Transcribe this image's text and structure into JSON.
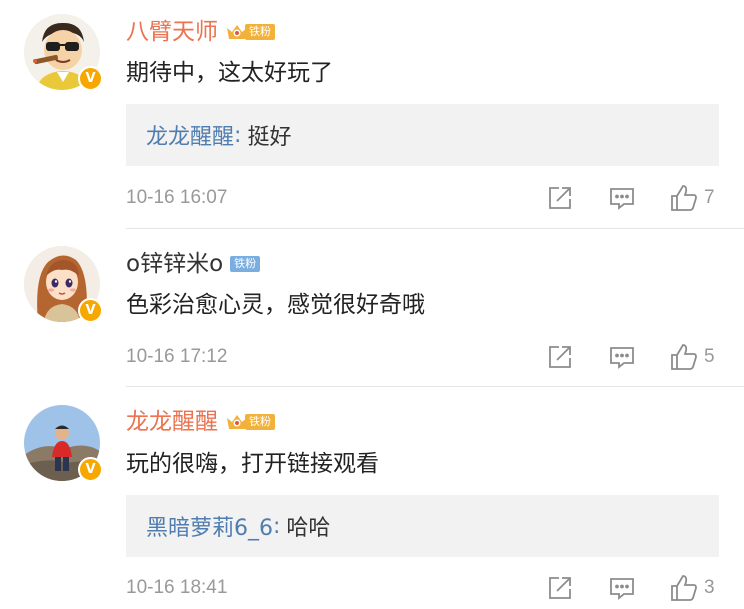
{
  "comments": [
    {
      "username": "八臂天师",
      "fan_badge": "铁粉",
      "text": "期待中，这太好玩了",
      "reply": {
        "user": "龙龙醒醒",
        "colon": ":",
        "text": "挺好"
      },
      "time": "10-16 16:07",
      "likes": "7"
    },
    {
      "username": "o锌锌米o",
      "fan_badge": "铁粉",
      "text": "色彩治愈心灵，感觉很好奇哦",
      "time": "10-16 17:12",
      "likes": "5"
    },
    {
      "username": "龙龙醒醒",
      "fan_badge": "铁粉",
      "text": "玩的很嗨，打开链接观看",
      "reply": {
        "user": "黑暗萝莉6_6",
        "colon": ":",
        "text": "哈哈"
      },
      "time": "10-16 18:41",
      "likes": "3"
    }
  ],
  "verified_mark": "V",
  "colors": {
    "username_vip": "#eb7350",
    "reply_user": "#507daf",
    "meta": "#999999",
    "verified_badge": "#f7a800"
  },
  "icons": [
    "share-icon",
    "comment-icon",
    "like-icon",
    "verified-badge-icon",
    "crown-icon"
  ]
}
